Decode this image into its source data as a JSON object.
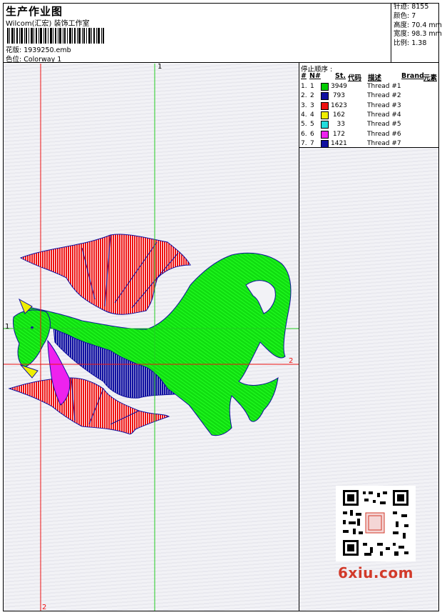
{
  "header": {
    "title": "生产作业图",
    "subtitle": "Wilcom(汇宏) 装饰工作室",
    "design_file": "花版: 1939250.emb",
    "colorway": "色位: Colorway 1"
  },
  "stats": {
    "stitches": "针迹: 8155",
    "colors": "颜色: 7",
    "height": "高度: 70.4 mm",
    "width": "宽度: 98.3 mm",
    "scale": "比例: 1.38"
  },
  "stop_sequence": {
    "title": "停止顺序 :",
    "headers": {
      "num": "#",
      "n": "N#",
      "st": "St.",
      "code": "代码",
      "desc": "描述",
      "brand": "Brand",
      "element": "元素"
    },
    "rows": [
      {
        "num": "1.",
        "n": "1",
        "color": "#00cc00",
        "st": "3949",
        "desc": "Thread #1"
      },
      {
        "num": "2.",
        "n": "2",
        "color": "#1010a0",
        "st": "793",
        "desc": "Thread #2"
      },
      {
        "num": "3.",
        "n": "3",
        "color": "#ee1111",
        "st": "1623",
        "desc": "Thread #3"
      },
      {
        "num": "4.",
        "n": "4",
        "color": "#eeee00",
        "st": "162",
        "desc": "Thread #4"
      },
      {
        "num": "5.",
        "n": "5",
        "color": "#22dddd",
        "st": "33",
        "desc": "Thread #5"
      },
      {
        "num": "6.",
        "n": "6",
        "color": "#ee22ee",
        "st": "172",
        "desc": "Thread #6"
      },
      {
        "num": "7.",
        "n": "7",
        "color": "#1010a0",
        "st": "1421",
        "desc": "Thread #7"
      }
    ]
  },
  "guides": {
    "top_label": "1",
    "left_label": "1",
    "right_label": "2",
    "bottom_label": "2"
  },
  "watermark": {
    "logo_text": "6xiu.com",
    "icon": "qr-code-icon"
  },
  "colors": {
    "guide_red": "#ee1111",
    "guide_green": "#22cc22"
  }
}
